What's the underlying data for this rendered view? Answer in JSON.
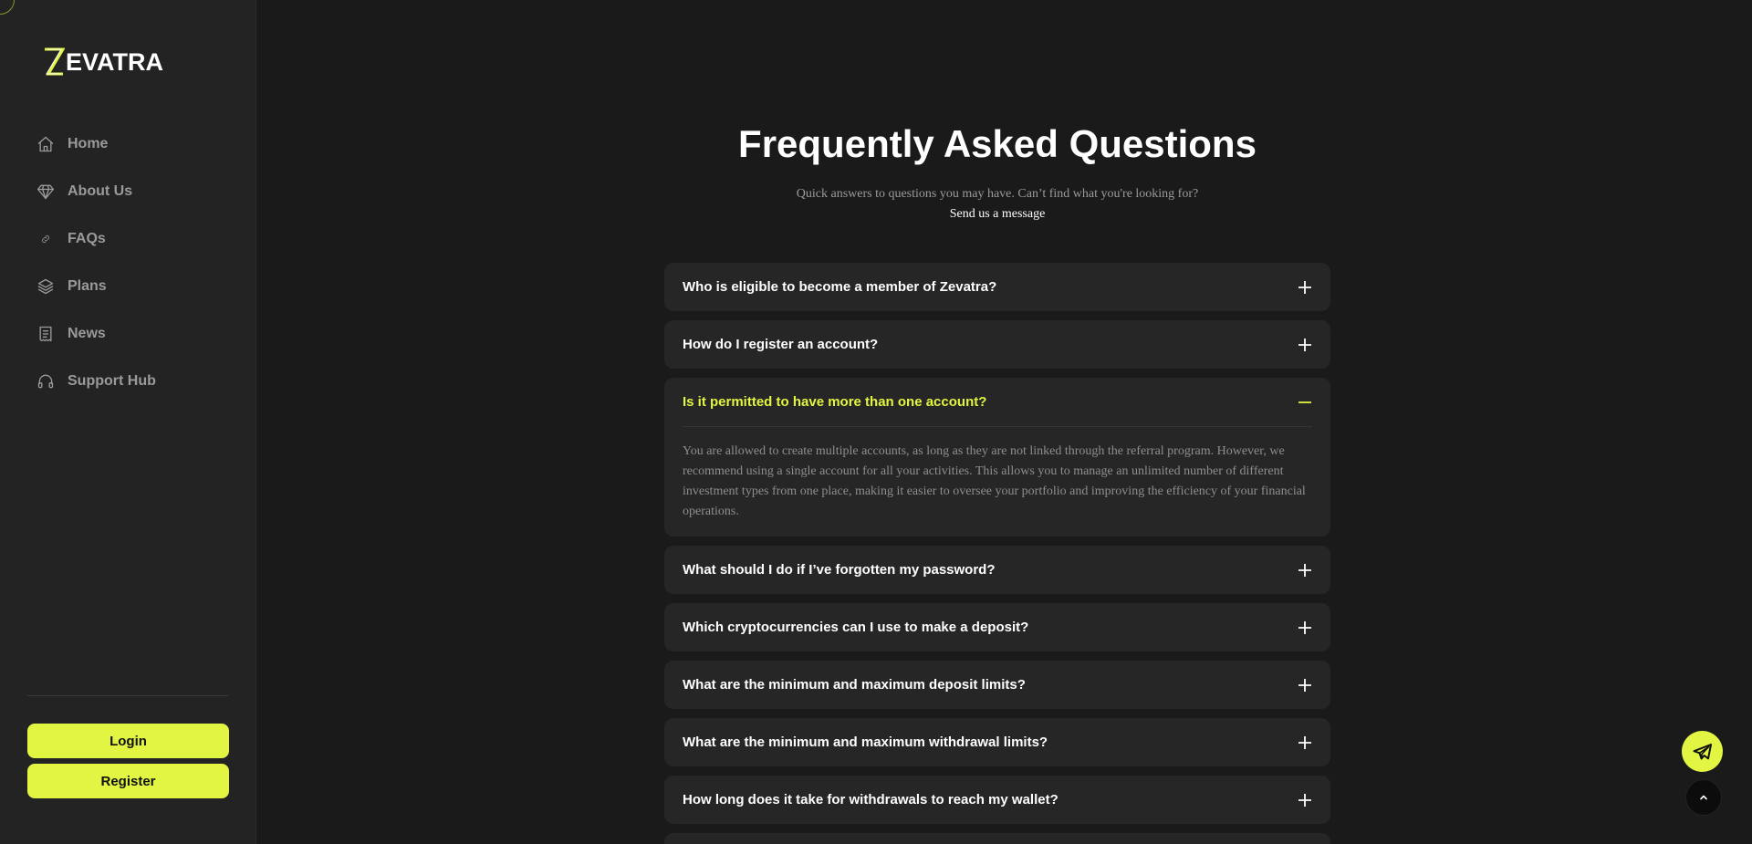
{
  "brand": {
    "name": "EVATRA",
    "accent": "#e2f542"
  },
  "sidebar": {
    "items": [
      {
        "label": "Home",
        "icon": "home-icon"
      },
      {
        "label": "About Us",
        "icon": "diamond-icon"
      },
      {
        "label": "FAQs",
        "icon": "link-icon"
      },
      {
        "label": "Plans",
        "icon": "layers-icon"
      },
      {
        "label": "News",
        "icon": "receipt-icon"
      },
      {
        "label": "Support Hub",
        "icon": "headset-icon"
      }
    ],
    "login_label": "Login",
    "register_label": "Register"
  },
  "main": {
    "title": "Frequently Asked Questions",
    "subtitle": "Quick answers to questions you may have. Can’t find what you're looking for?",
    "send_link": "Send us a message",
    "faqs": [
      {
        "question": "Who is eligible to become a member of Zevatra?",
        "open": false
      },
      {
        "question": "How do I register an account?",
        "open": false
      },
      {
        "question": "Is it permitted to have more than one account?",
        "open": true,
        "answer": "You are allowed to create multiple accounts, as long as they are not linked through the referral program. However, we recommend using a single account for all your activities. This allows you to manage an unlimited number of different investment types from one place, making it easier to oversee your portfolio and improving the efficiency of your financial operations."
      },
      {
        "question": "What should I do if I’ve forgotten my password?",
        "open": false
      },
      {
        "question": "Which cryptocurrencies can I use to make a deposit?",
        "open": false
      },
      {
        "question": "What are the minimum and maximum deposit limits?",
        "open": false
      },
      {
        "question": "What are the minimum and maximum withdrawal limits?",
        "open": false
      },
      {
        "question": "How long does it take for withdrawals to reach my wallet?",
        "open": false
      }
    ]
  },
  "floating": {
    "telegram_icon": "telegram-icon",
    "top_icon": "chevron-up-icon"
  }
}
